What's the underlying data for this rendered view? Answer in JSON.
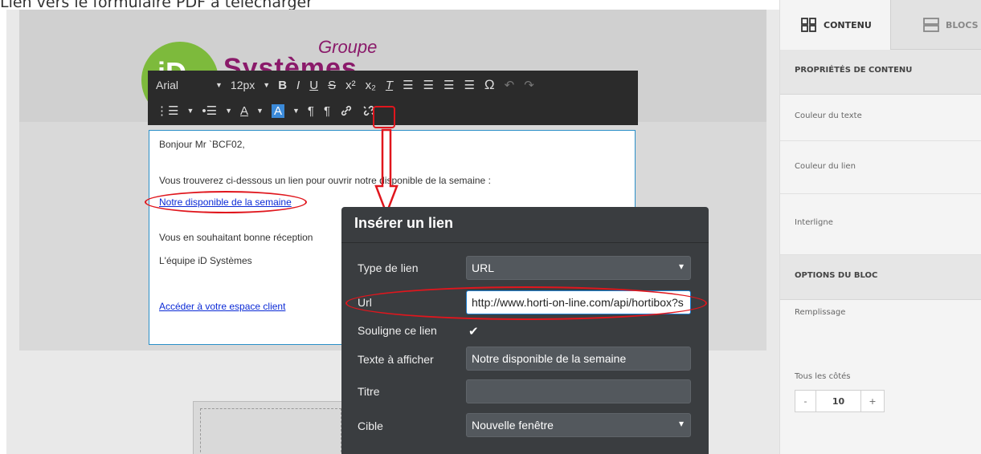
{
  "caption": "Lien vers le formulaire PDF à télécharger",
  "logo": {
    "groupe": "Groupe",
    "systemes": "Systèmes",
    "initials": "iD"
  },
  "toolbar": {
    "font": "Arial",
    "size": "12px",
    "row1_icons": [
      "bold-icon",
      "italic-icon",
      "underline-icon",
      "strikethrough-icon",
      "superscript-icon",
      "subscript-icon",
      "clear-format-icon",
      "align-left-icon",
      "align-center-icon",
      "align-right-icon",
      "justify-icon",
      "special-char-icon",
      "undo-icon",
      "redo-icon"
    ],
    "row2_icons": [
      "ordered-list-icon",
      "bullet-list-icon",
      "text-color-icon",
      "bg-color-icon",
      "ltr-icon",
      "rtl-icon",
      "link-icon",
      "unlink-icon"
    ]
  },
  "email_body": {
    "greeting": "Bonjour Mr `BCF02,",
    "intro": "Vous trouverez ci-dessous un lien pour ouvrir notre disponible de la semaine :",
    "link_text": "Notre disponible de la semaine",
    "closing": "Vous en souhaitant bonne réception",
    "signature": "L'équipe iD Systèmes",
    "client_link": "Accéder à votre espace client"
  },
  "dialog": {
    "title": "Insérer un lien",
    "link_type_label": "Type de lien",
    "link_type_value": "URL",
    "url_label": "Url",
    "url_value": "http://www.horti-on-line.com/api/hortibox?s",
    "underline_label": "Souligne ce lien",
    "underline_checked": true,
    "display_text_label": "Texte à afficher",
    "display_text_value": "Notre disponible de la semaine",
    "title_label": "Titre",
    "title_value": "",
    "target_label": "Cible",
    "target_value": "Nouvelle fenêtre"
  },
  "right_panel": {
    "tab_content": "CONTENU",
    "tab_blocks": "BLOCS",
    "content_props_header": "PROPRIÉTÉS DE CONTENU",
    "text_color": "Couleur du texte",
    "link_color": "Couleur du lien",
    "line_height": "Interligne",
    "block_options_header": "OPTIONS DU BLOC",
    "padding": "Remplissage",
    "all_sides": "Tous les côtés",
    "stepper_minus": "-",
    "stepper_value": "10",
    "stepper_plus": "+"
  },
  "colors": {
    "highlight_red": "#e0161d",
    "brand_purple": "#8a1a6a",
    "brand_green": "#7dba3c",
    "link_blue": "#0b2ad6"
  }
}
